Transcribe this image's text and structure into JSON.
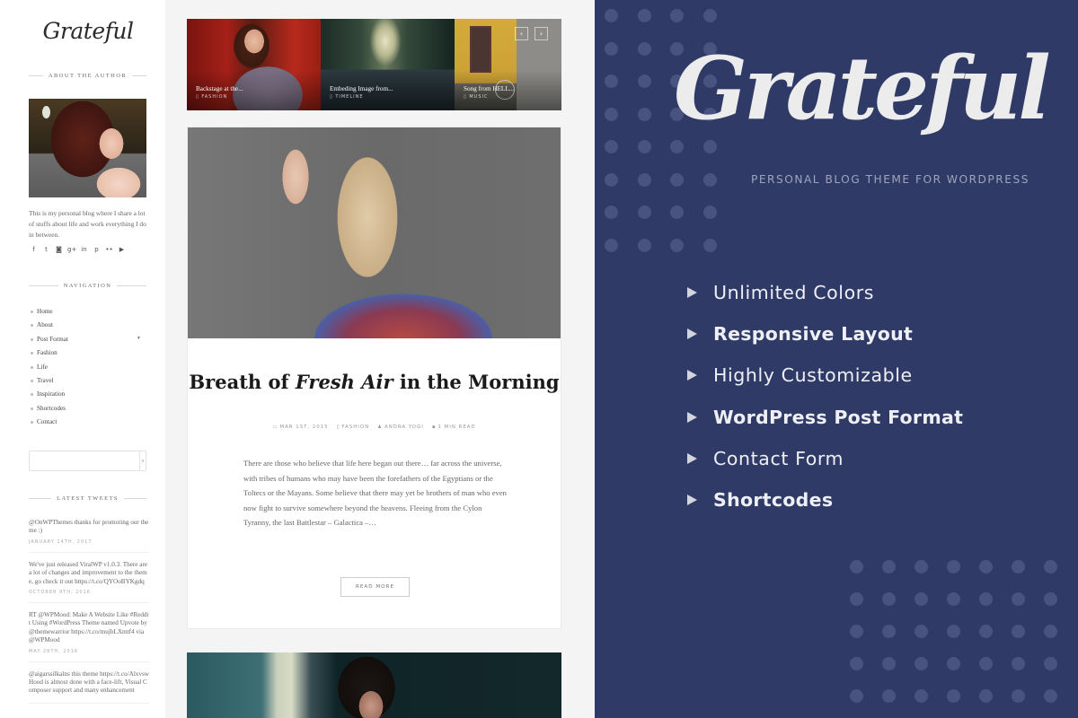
{
  "sidebar": {
    "logo": "Grateful",
    "about_title": "About the Author",
    "author_bio": "This is my personal blog where I share a lot of stuffs about life and work everything I do in between.",
    "social_icons": [
      {
        "name": "facebook-icon",
        "glyph": "f"
      },
      {
        "name": "twitter-icon",
        "glyph": "t"
      },
      {
        "name": "instagram-icon",
        "glyph": "◙"
      },
      {
        "name": "google-plus-icon",
        "glyph": "g+"
      },
      {
        "name": "linkedin-icon",
        "glyph": "in"
      },
      {
        "name": "pinterest-icon",
        "glyph": "p"
      },
      {
        "name": "flickr-icon",
        "glyph": "••"
      },
      {
        "name": "youtube-icon",
        "glyph": "▶"
      }
    ],
    "nav_title": "Navigation",
    "nav_items": [
      {
        "label": "Home"
      },
      {
        "label": "About"
      },
      {
        "label": "Post Format",
        "has_submenu": true
      },
      {
        "label": "Fashion"
      },
      {
        "label": "Life"
      },
      {
        "label": "Travel"
      },
      {
        "label": "Inspiration"
      },
      {
        "label": "Shortcodes"
      },
      {
        "label": "Contact"
      }
    ],
    "search": {
      "placeholder": "",
      "value": "",
      "submit_glyph": "›"
    },
    "tweets_title": "Latest Tweets",
    "tweets": [
      {
        "text": "@OnWPThemes thanks for promoting our theme :)",
        "date": "January 14th, 2017"
      },
      {
        "text": "We've just released ViralWP v1.0.3. There are a lot of changes and improvement to the theme, go check it out https://t.co/QYOoBYKgdq",
        "date": "October 9th, 2016"
      },
      {
        "text": "RT @WPMood: Make A Website Like #Reddit Using #WordPress Theme named Upvote by @themewarrior https://t.co/mujbLXmtf4 via @WPMood",
        "date": "May 28th, 2016"
      },
      {
        "text": "@aigarssilkalns this theme https://t.co/AlxvswHood is almost done with a face-lift, Visual Composer support and many enhancement",
        "date": ""
      }
    ]
  },
  "slider": {
    "slides": [
      {
        "title": "Backstage at the...",
        "category": "Fashion"
      },
      {
        "title": "Embeding Image from...",
        "category": "Timeline"
      },
      {
        "title": "Song from HELL...",
        "category": "Music"
      }
    ],
    "prev_glyph": "‹",
    "next_glyph": "›"
  },
  "post": {
    "title_before": "Breath of ",
    "title_emphasis": "Fresh Air",
    "title_after": " in the Morning",
    "meta": {
      "date": "Mar 1st, 2015",
      "category": "Fashion",
      "author": "Andra Yogi",
      "read_time": "1 Min Read"
    },
    "excerpt": "There are those who believe that life here began out there… far across the universe, with tribes of humans who may have been the forefathers of the Egyptians or the Toltecs or the Mayans. Some believe that there may yet be brothers of man who even now fight to survive somewhere beyond the heavens. Fleeing from the Cylon Tyranny, the last Battlestar – Galactica –…",
    "read_more": "Read More"
  },
  "promo": {
    "logo": "Grateful",
    "subtitle": "Personal Blog Theme for WordPress",
    "features": [
      {
        "label": "Unlimited Colors",
        "bold": false
      },
      {
        "label": "Responsive Layout",
        "bold": true
      },
      {
        "label": "Highly Customizable",
        "bold": false
      },
      {
        "label": "WordPress Post Format",
        "bold": true
      },
      {
        "label": "Contact Form",
        "bold": false
      },
      {
        "label": "Shortcodes",
        "bold": true
      }
    ]
  },
  "colors": {
    "promo_bg": "#2f3a66",
    "promo_dot": "#48547f",
    "page_bg": "#f4f4f4"
  }
}
